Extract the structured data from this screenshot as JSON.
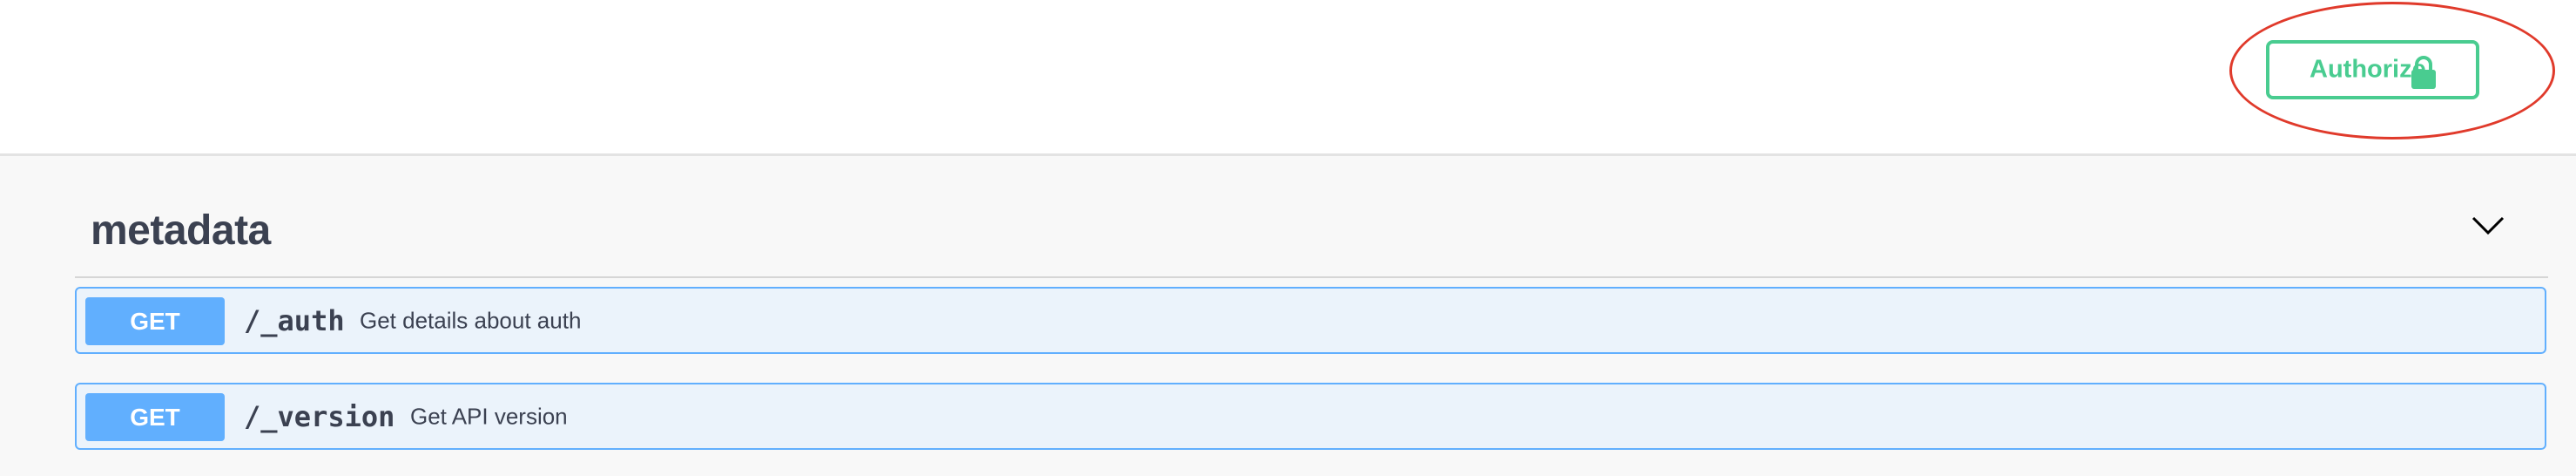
{
  "header": {
    "authorize_label": "Authorize",
    "authorize_icon": "lock-icon",
    "accent_color": "#49cc90",
    "highlight_color": "#e03a2b"
  },
  "section": {
    "title": "metadata",
    "toggle_icon": "chevron-down-icon"
  },
  "operations": [
    {
      "method": "GET",
      "path": "/_auth",
      "summary": "Get details about auth"
    },
    {
      "method": "GET",
      "path": "/_version",
      "summary": "Get API version"
    }
  ],
  "colors": {
    "get_method": "#61affe",
    "get_row_bg": "#ebf3fb",
    "text": "#3b4151"
  }
}
